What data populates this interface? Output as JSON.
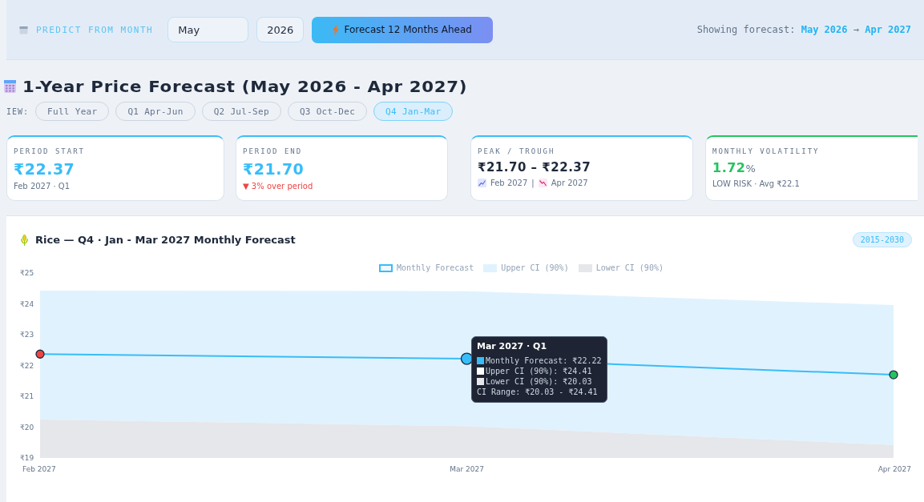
{
  "controls": {
    "label": "PREDICT FROM MONTH",
    "month": "May",
    "year": "2026",
    "button": "Forecast 12 Months Ahead",
    "showing_label": "Showing forecast:",
    "range_start": "May 2026",
    "arrow": "→",
    "range_end": "Apr 2027"
  },
  "heading": {
    "title": "1-Year Price Forecast (May 2026 - Apr 2027)",
    "view_label": "IEW:",
    "views": [
      {
        "label": "Full Year",
        "selected": false
      },
      {
        "label": "Q1 Apr-Jun",
        "selected": false
      },
      {
        "label": "Q2 Jul-Sep",
        "selected": false
      },
      {
        "label": "Q3 Oct-Dec",
        "selected": false
      },
      {
        "label": "Q4 Jan-Mar",
        "selected": true
      }
    ]
  },
  "cards": [
    {
      "kind": "price",
      "label": "PERIOD START",
      "value": "₹22.37",
      "sub": "Feb 2027 · Q1",
      "color": "#38bdf8"
    },
    {
      "kind": "change",
      "label": "PERIOD END",
      "value": "₹21.70",
      "sub": "▼ 3% over period",
      "color": "#38bdf8"
    },
    {
      "kind": "range",
      "label": "PEAK / TROUGH",
      "value": "₹21.70 – ₹22.37",
      "peak_date": "Feb 2027",
      "separator": "|",
      "trough_date": "Apr 2027",
      "color": "#38bdf8"
    },
    {
      "kind": "volatility",
      "label": "MONTHLY VOLATILITY",
      "value": "1.72",
      "unit": "%",
      "sub": "LOW RISK · Avg ₹22.1",
      "color": "#22c55e"
    }
  ],
  "chart_panel": {
    "title": "Rice — Q4 · Jan - Mar 2027 Monthly Forecast",
    "badge": "2015-2030",
    "chart_data": {
      "type": "line",
      "categories": [
        "Feb 2027",
        "Mar 2027",
        "Apr 2027"
      ],
      "series": [
        {
          "name": "Upper CI (90%)",
          "type": "area",
          "color": "#e0f2fe",
          "values": [
            24.43,
            24.41,
            23.96
          ]
        },
        {
          "name": "Lower CI (90%)",
          "type": "area",
          "color": "#e5e7eb",
          "values": [
            20.25,
            20.03,
            19.42
          ]
        },
        {
          "name": "Monthly Forecast",
          "type": "line",
          "marker": true,
          "color": "#38bdf8",
          "values": [
            22.37,
            22.22,
            21.7
          ]
        }
      ],
      "ylim": [
        19,
        25
      ],
      "yticks": [
        {
          "value": 19,
          "label": "₹19"
        },
        {
          "value": 20,
          "label": "₹20"
        },
        {
          "value": 21,
          "label": "₹21"
        },
        {
          "value": 22,
          "label": "₹22"
        },
        {
          "value": 23,
          "label": "₹23"
        },
        {
          "value": 24,
          "label": "₹24"
        },
        {
          "value": 25,
          "label": "₹25"
        }
      ]
    },
    "point_markers": [
      {
        "color": "#ef4444",
        "selected": false
      },
      {
        "color": "#38bdf8",
        "selected": true
      },
      {
        "color": "#22c55e",
        "selected": false
      }
    ],
    "tooltip": {
      "title": "Mar 2027 · Q1",
      "rows": [
        {
          "text": "Monthly Forecast: ₹22.22",
          "color": "#38bdf8"
        },
        {
          "text": "Upper CI (90%): ₹24.41",
          "color": "#ffffff"
        },
        {
          "text": "Lower CI (90%): ₹20.03",
          "color": "#e5e7eb"
        },
        {
          "text": "CI Range: ₹20.03 - ₹24.41"
        }
      ]
    }
  }
}
